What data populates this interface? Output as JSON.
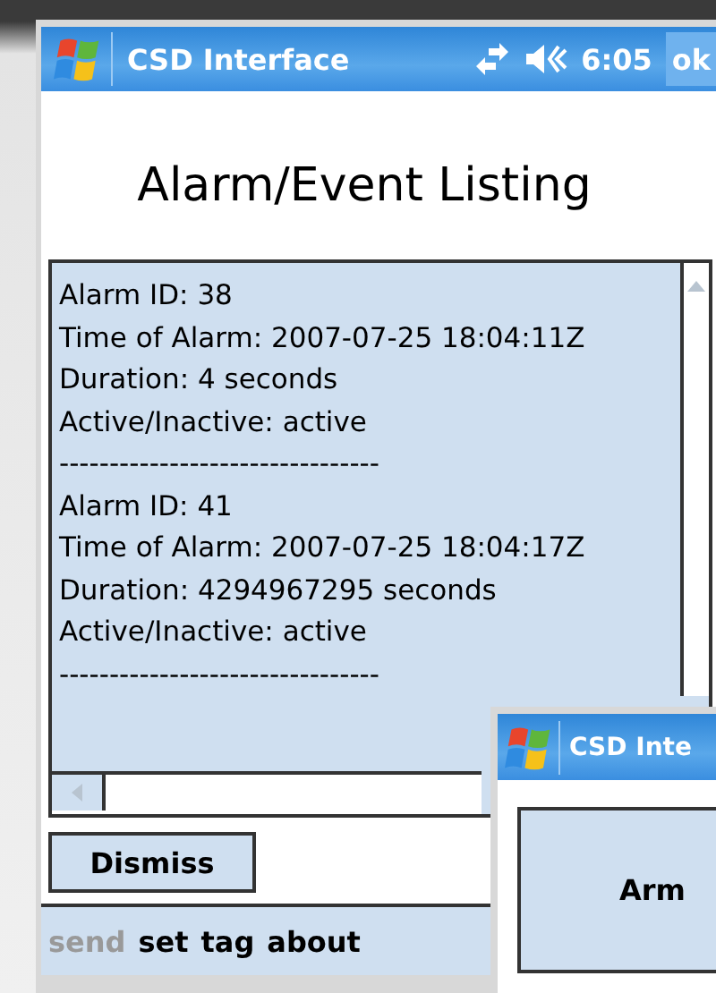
{
  "main_window": {
    "title": "CSD Interface",
    "time": "6:05",
    "ok_button": "ok",
    "heading": "Alarm/Event Listing",
    "listing": [
      "Alarm ID: 38",
      "Time of Alarm: 2007-07-25 18:04:11Z",
      "Duration: 4 seconds",
      "Active/Inactive: active",
      "--------------------------------",
      "Alarm ID: 41",
      "Time of Alarm: 2007-07-25 18:04:17Z",
      "Duration: 4294967295 seconds",
      "Active/Inactive: active",
      "--------------------------------"
    ],
    "dismiss_button": "Dismiss",
    "menu": [
      {
        "label": "send",
        "disabled": true
      },
      {
        "label": "set",
        "disabled": false
      },
      {
        "label": "tag",
        "disabled": false
      },
      {
        "label": "about",
        "disabled": false
      }
    ]
  },
  "overlay_window": {
    "title": "CSD Inte",
    "button": "Arm"
  }
}
